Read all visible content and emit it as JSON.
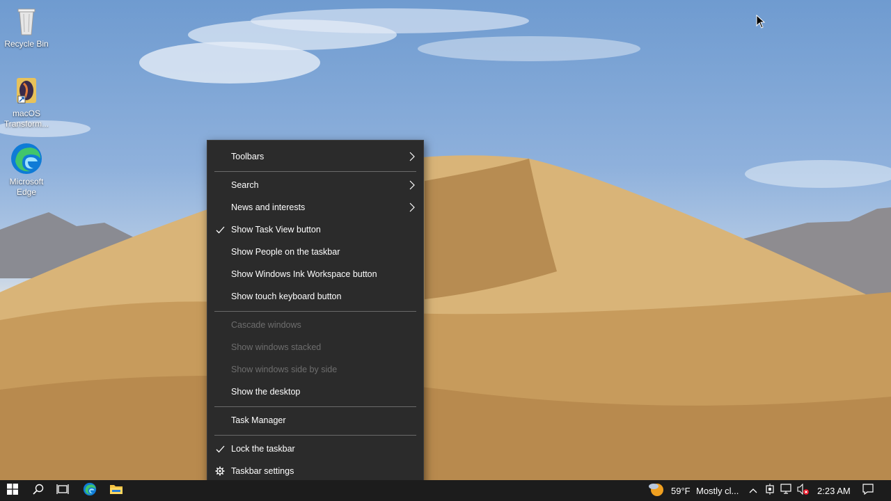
{
  "desktop": {
    "icons": [
      {
        "label": "Recycle Bin",
        "icon": "recycle-bin-icon"
      },
      {
        "label": "macOS Transform...",
        "icon": "macos-transformation-icon"
      },
      {
        "label": "Microsoft Edge",
        "icon": "edge-icon"
      }
    ]
  },
  "context_menu": {
    "items": [
      {
        "label": "Toolbars",
        "submenu": true
      },
      {
        "label": "Search",
        "submenu": true
      },
      {
        "label": "News and interests",
        "submenu": true
      },
      {
        "label": "Show Task View button",
        "checked": true
      },
      {
        "label": "Show People on the taskbar"
      },
      {
        "label": "Show Windows Ink Workspace button"
      },
      {
        "label": "Show touch keyboard button"
      },
      {
        "label": "Cascade windows",
        "disabled": true
      },
      {
        "label": "Show windows stacked",
        "disabled": true
      },
      {
        "label": "Show windows side by side",
        "disabled": true
      },
      {
        "label": "Show the desktop"
      },
      {
        "label": "Task Manager"
      },
      {
        "label": "Lock the taskbar",
        "checked": true
      },
      {
        "label": "Taskbar settings",
        "icon": "gear-icon"
      }
    ]
  },
  "taskbar": {
    "weather": {
      "temp": "59°F",
      "condition": "Mostly cl..."
    },
    "clock": "2:23 AM",
    "accent": "#0078d4"
  }
}
